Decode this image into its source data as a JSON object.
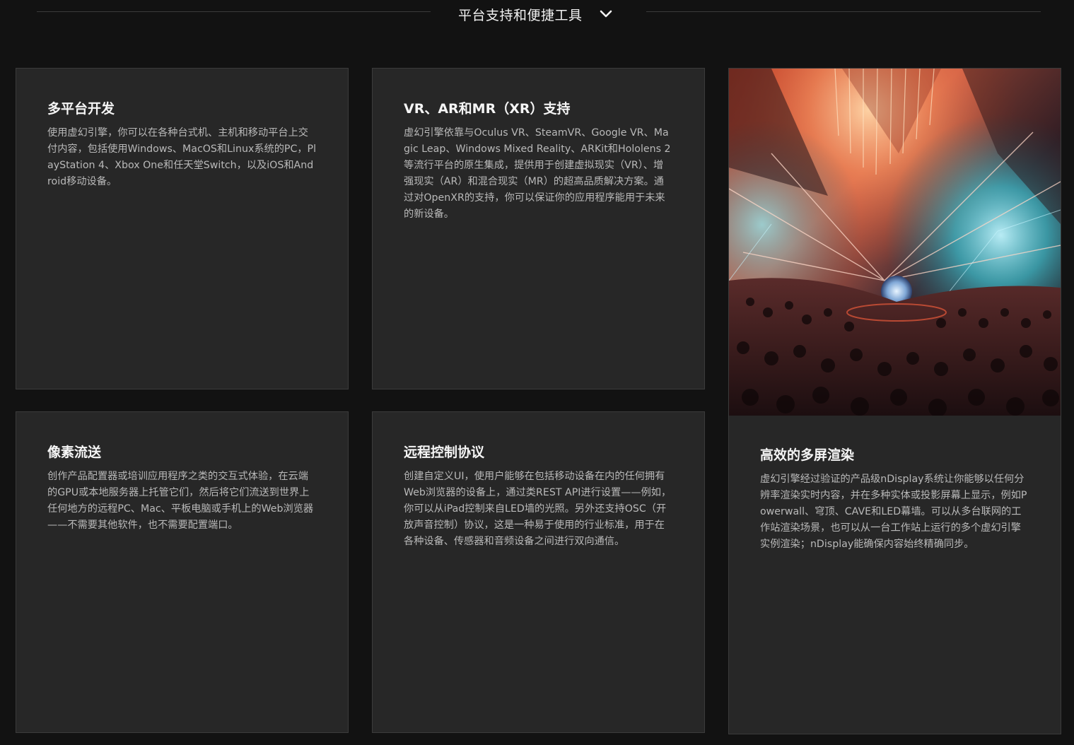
{
  "section": {
    "title": "平台支持和便捷工具",
    "toggle_icon": "chevron-down-icon"
  },
  "cards": {
    "multiplatform": {
      "title": "多平台开发",
      "text": "使用虚幻引擎，你可以在各种台式机、主机和移动平台上交付内容，包括使用Windows、MacOS和Linux系统的PC，PlayStation 4、Xbox One和任天堂Switch，以及iOS和Android移动设备。"
    },
    "xr": {
      "title": "VR、AR和MR（XR）支持",
      "text": "虚幻引擎依靠与Oculus VR、SteamVR、Google VR、Magic Leap、Windows Mixed Reality、ARKit和Hololens 2等流行平台的原生集成，提供用于创建虚拟现实（VR）、增强现实（AR）和混合现实（MR）的超高品质解决方案。通过对OpenXR的支持，你可以保证你的应用程序能用于未来的新设备。"
    },
    "pixel": {
      "title": "像素流送",
      "text": "创作产品配置器或培训应用程序之类的交互式体验，在云端的GPU或本地服务器上托管它们，然后将它们流送到世界上任何地方的远程PC、Mac、平板电脑或手机上的Web浏览器——不需要其他软件，也不需要配置端口。"
    },
    "remote": {
      "title": "远程控制协议",
      "text": "创建自定义UI，使用户能够在包括移动设备在内的任何拥有Web浏览器的设备上，通过类REST API进行设置——例如，你可以从iPad控制来自LED墙的光照。另外还支持OSC（开放声音控制）协议，这是一种易于使用的行业标准，用于在各种设备、传感器和音频设备之间进行双向通信。"
    },
    "ndisplay": {
      "title": "高效的多屏渲染",
      "text": "虚幻引擎经过验证的产品级nDisplay系统让你能够以任何分辨率渲染实时内容，并在多种实体或投影屏幕上显示，例如Powerwall、穹顶、CAVE和LED幕墙。可以从多台联网的工作站渲染场景，也可以从一台工作站上运行的多个虚幻引擎实例渲染；nDisplay能确保内容始终精确同步。"
    }
  }
}
